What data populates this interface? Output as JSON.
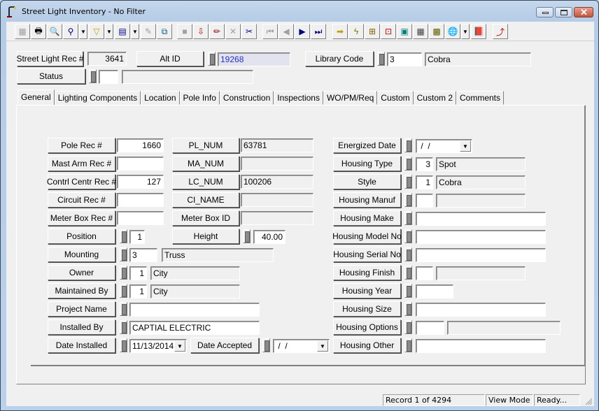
{
  "window": {
    "title": "Street Light Inventory - No Filter",
    "controls": {
      "minimize": "minimize",
      "maximize": "maximize",
      "close": "close"
    }
  },
  "toolbar": {
    "buttons": [
      {
        "name": "form-view-button",
        "glyph": "▦",
        "enabled": false
      },
      {
        "name": "print-button",
        "glyph": "🖶",
        "enabled": true
      },
      {
        "name": "print-preview-button",
        "glyph": "🔍",
        "enabled": true
      },
      {
        "name": "find-button",
        "glyph": "⚲",
        "enabled": true
      },
      {
        "name": "filter-button",
        "glyph": "▽",
        "enabled": true
      },
      {
        "name": "report-button",
        "glyph": "▤",
        "enabled": true
      },
      {
        "name": "edit-form-button",
        "glyph": "✎",
        "enabled": false
      },
      {
        "name": "copy-record-button",
        "glyph": "⧉",
        "enabled": true
      },
      {
        "name": "save-button",
        "glyph": "■",
        "enabled": false
      },
      {
        "name": "add-record-button",
        "glyph": "⇩",
        "enabled": true
      },
      {
        "name": "edit-button",
        "glyph": "✏",
        "enabled": true
      },
      {
        "name": "delete-button",
        "glyph": "✕",
        "enabled": false
      },
      {
        "name": "cut-button",
        "glyph": "✂",
        "enabled": true
      },
      {
        "name": "first-record-button",
        "glyph": "⏮",
        "enabled": false
      },
      {
        "name": "previous-record-button",
        "glyph": "◀",
        "enabled": false
      },
      {
        "name": "next-record-button",
        "glyph": "▶",
        "enabled": true
      },
      {
        "name": "last-record-button",
        "glyph": "⏭",
        "enabled": true
      },
      {
        "name": "goto-button",
        "glyph": "➡",
        "enabled": true
      },
      {
        "name": "quick-action-button",
        "glyph": "ϟ",
        "enabled": true
      },
      {
        "name": "related-records-button",
        "glyph": "⊞",
        "enabled": true
      },
      {
        "name": "link-button",
        "glyph": "⊡",
        "enabled": true
      },
      {
        "name": "work-order-button",
        "glyph": "▣",
        "enabled": true
      },
      {
        "name": "calculator-button",
        "glyph": "▦",
        "enabled": true
      },
      {
        "name": "map-button",
        "glyph": "▩",
        "enabled": true
      },
      {
        "name": "gis-button",
        "glyph": "🌐",
        "enabled": true
      },
      {
        "name": "help-book-button",
        "glyph": "📕",
        "enabled": true
      },
      {
        "name": "exit-button",
        "glyph": "⤴",
        "enabled": true
      }
    ]
  },
  "header": {
    "street_light_rec_label": "Street Light Rec #",
    "street_light_rec_value": "3641",
    "alt_id_label": "Alt ID",
    "alt_id_value": "19268",
    "library_code_label": "Library Code",
    "library_code_value": "3",
    "library_code_desc": "Cobra",
    "status_label": "Status",
    "status_value": "",
    "status_desc": ""
  },
  "tabs": [
    {
      "label": "General",
      "active": true
    },
    {
      "label": "Lighting Components",
      "active": false
    },
    {
      "label": "Location",
      "active": false
    },
    {
      "label": "Pole Info",
      "active": false
    },
    {
      "label": "Construction",
      "active": false
    },
    {
      "label": "Inspections",
      "active": false
    },
    {
      "label": "WO/PM/Req",
      "active": false
    },
    {
      "label": "Custom",
      "active": false
    },
    {
      "label": "Custom 2",
      "active": false
    },
    {
      "label": "Comments",
      "active": false
    }
  ],
  "general": {
    "pole_rec_label": "Pole Rec #",
    "pole_rec_value": "1660",
    "mast_arm_rec_label": "Mast Arm Rec #",
    "mast_arm_rec_value": "",
    "contrl_centr_rec_label": "Contrl Centr Rec #",
    "contrl_centr_rec_value": "127",
    "circuit_rec_label": "Circuit Rec #",
    "circuit_rec_value": "",
    "meter_box_rec_label": "Meter Box Rec #",
    "meter_box_rec_value": "",
    "pl_num_label": "PL_NUM",
    "pl_num_value": "63781",
    "ma_num_label": "MA_NUM",
    "ma_num_value": "",
    "lc_num_label": "LC_NUM",
    "lc_num_value": "100206",
    "ci_name_label": "CI_NAME",
    "ci_name_value": "",
    "meter_box_id_label": "Meter Box ID",
    "meter_box_id_value": "",
    "position_label": "Position",
    "position_value": "1",
    "height_label": "Height",
    "height_value": "40.00",
    "mounting_label": "Mounting",
    "mounting_value": "3",
    "mounting_desc": "Truss",
    "owner_label": "Owner",
    "owner_value": "1",
    "owner_desc": "City",
    "maintained_by_label": "Maintained By",
    "maintained_by_value": "1",
    "maintained_by_desc": "City",
    "project_name_label": "Project Name",
    "project_name_value": "",
    "installed_by_label": "Installed By",
    "installed_by_value": "CAPTIAL ELECTRIC",
    "date_installed_label": "Date Installed",
    "date_installed_value": "11/13/2014",
    "date_accepted_label": "Date Accepted",
    "date_accepted_value": " /  /",
    "energized_date_label": "Energized Date",
    "energized_date_value": " /  /",
    "housing_type_label": "Housing Type",
    "housing_type_value": "3",
    "housing_type_desc": "Spot",
    "style_label": "Style",
    "style_value": "1",
    "style_desc": "Cobra",
    "housing_manuf_label": "Housing Manuf",
    "housing_manuf_value": "",
    "housing_manuf_desc": "",
    "housing_make_label": "Housing Make",
    "housing_make_value": "",
    "housing_model_no_label": "Housing Model No",
    "housing_model_no_value": "",
    "housing_serial_no_label": "Housing Serial No",
    "housing_serial_no_value": "",
    "housing_finish_label": "Housing Finish",
    "housing_finish_value": "",
    "housing_finish_desc": "",
    "housing_year_label": "Housing Year",
    "housing_year_value": "",
    "housing_size_label": "Housing Size",
    "housing_size_value": "",
    "housing_options_label": "Housing Options",
    "housing_options_value": "",
    "housing_options_desc": "",
    "housing_other_label": "Housing Other",
    "housing_other_value": ""
  },
  "statusbar": {
    "record": "Record 1 of 4294",
    "mode": "View Mode",
    "state": "Ready..."
  }
}
